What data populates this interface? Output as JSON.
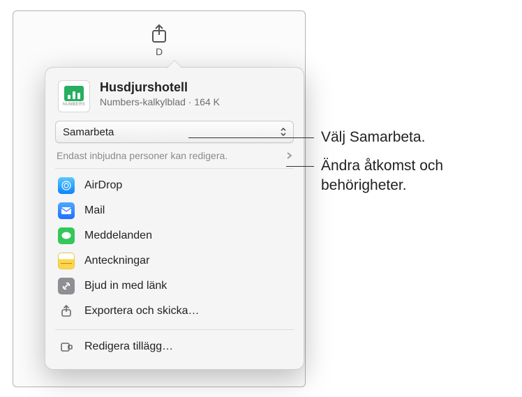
{
  "toolbar": {
    "share_under_text": "D"
  },
  "document": {
    "title": "Husdjurshotell",
    "type_label": "Numbers-kalkylblad",
    "size_label": "164 K",
    "icon_app_label": "NUMBERS"
  },
  "collaboration": {
    "mode_label": "Samarbeta",
    "permission_summary": "Endast inbjudna personer kan redigera."
  },
  "share_options": [
    {
      "key": "airdrop",
      "label": "AirDrop"
    },
    {
      "key": "mail",
      "label": "Mail"
    },
    {
      "key": "messages",
      "label": "Meddelanden"
    },
    {
      "key": "notes",
      "label": "Anteckningar"
    },
    {
      "key": "link",
      "label": "Bjud in med länk"
    },
    {
      "key": "export",
      "label": "Exportera och skicka…"
    }
  ],
  "edit_extensions_label": "Redigera tillägg…",
  "callouts": {
    "collaborate": "Välj Samarbeta.",
    "permissions_line1": "Ändra åtkomst och",
    "permissions_line2": "behörigheter."
  }
}
